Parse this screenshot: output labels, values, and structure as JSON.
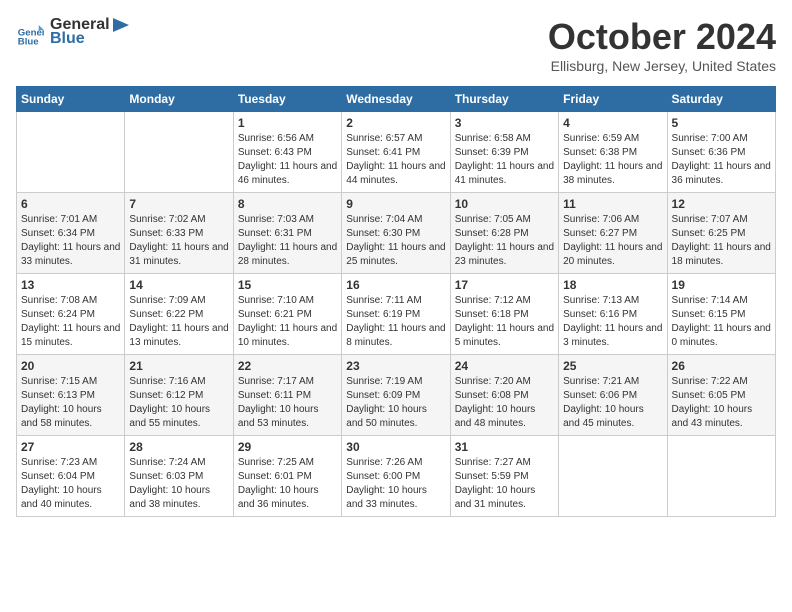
{
  "header": {
    "logo_line1": "General",
    "logo_line2": "Blue",
    "month": "October 2024",
    "location": "Ellisburg, New Jersey, United States"
  },
  "days_of_week": [
    "Sunday",
    "Monday",
    "Tuesday",
    "Wednesday",
    "Thursday",
    "Friday",
    "Saturday"
  ],
  "weeks": [
    [
      {
        "day": "",
        "info": ""
      },
      {
        "day": "",
        "info": ""
      },
      {
        "day": "1",
        "info": "Sunrise: 6:56 AM\nSunset: 6:43 PM\nDaylight: 11 hours and 46 minutes."
      },
      {
        "day": "2",
        "info": "Sunrise: 6:57 AM\nSunset: 6:41 PM\nDaylight: 11 hours and 44 minutes."
      },
      {
        "day": "3",
        "info": "Sunrise: 6:58 AM\nSunset: 6:39 PM\nDaylight: 11 hours and 41 minutes."
      },
      {
        "day": "4",
        "info": "Sunrise: 6:59 AM\nSunset: 6:38 PM\nDaylight: 11 hours and 38 minutes."
      },
      {
        "day": "5",
        "info": "Sunrise: 7:00 AM\nSunset: 6:36 PM\nDaylight: 11 hours and 36 minutes."
      }
    ],
    [
      {
        "day": "6",
        "info": "Sunrise: 7:01 AM\nSunset: 6:34 PM\nDaylight: 11 hours and 33 minutes."
      },
      {
        "day": "7",
        "info": "Sunrise: 7:02 AM\nSunset: 6:33 PM\nDaylight: 11 hours and 31 minutes."
      },
      {
        "day": "8",
        "info": "Sunrise: 7:03 AM\nSunset: 6:31 PM\nDaylight: 11 hours and 28 minutes."
      },
      {
        "day": "9",
        "info": "Sunrise: 7:04 AM\nSunset: 6:30 PM\nDaylight: 11 hours and 25 minutes."
      },
      {
        "day": "10",
        "info": "Sunrise: 7:05 AM\nSunset: 6:28 PM\nDaylight: 11 hours and 23 minutes."
      },
      {
        "day": "11",
        "info": "Sunrise: 7:06 AM\nSunset: 6:27 PM\nDaylight: 11 hours and 20 minutes."
      },
      {
        "day": "12",
        "info": "Sunrise: 7:07 AM\nSunset: 6:25 PM\nDaylight: 11 hours and 18 minutes."
      }
    ],
    [
      {
        "day": "13",
        "info": "Sunrise: 7:08 AM\nSunset: 6:24 PM\nDaylight: 11 hours and 15 minutes."
      },
      {
        "day": "14",
        "info": "Sunrise: 7:09 AM\nSunset: 6:22 PM\nDaylight: 11 hours and 13 minutes."
      },
      {
        "day": "15",
        "info": "Sunrise: 7:10 AM\nSunset: 6:21 PM\nDaylight: 11 hours and 10 minutes."
      },
      {
        "day": "16",
        "info": "Sunrise: 7:11 AM\nSunset: 6:19 PM\nDaylight: 11 hours and 8 minutes."
      },
      {
        "day": "17",
        "info": "Sunrise: 7:12 AM\nSunset: 6:18 PM\nDaylight: 11 hours and 5 minutes."
      },
      {
        "day": "18",
        "info": "Sunrise: 7:13 AM\nSunset: 6:16 PM\nDaylight: 11 hours and 3 minutes."
      },
      {
        "day": "19",
        "info": "Sunrise: 7:14 AM\nSunset: 6:15 PM\nDaylight: 11 hours and 0 minutes."
      }
    ],
    [
      {
        "day": "20",
        "info": "Sunrise: 7:15 AM\nSunset: 6:13 PM\nDaylight: 10 hours and 58 minutes."
      },
      {
        "day": "21",
        "info": "Sunrise: 7:16 AM\nSunset: 6:12 PM\nDaylight: 10 hours and 55 minutes."
      },
      {
        "day": "22",
        "info": "Sunrise: 7:17 AM\nSunset: 6:11 PM\nDaylight: 10 hours and 53 minutes."
      },
      {
        "day": "23",
        "info": "Sunrise: 7:19 AM\nSunset: 6:09 PM\nDaylight: 10 hours and 50 minutes."
      },
      {
        "day": "24",
        "info": "Sunrise: 7:20 AM\nSunset: 6:08 PM\nDaylight: 10 hours and 48 minutes."
      },
      {
        "day": "25",
        "info": "Sunrise: 7:21 AM\nSunset: 6:06 PM\nDaylight: 10 hours and 45 minutes."
      },
      {
        "day": "26",
        "info": "Sunrise: 7:22 AM\nSunset: 6:05 PM\nDaylight: 10 hours and 43 minutes."
      }
    ],
    [
      {
        "day": "27",
        "info": "Sunrise: 7:23 AM\nSunset: 6:04 PM\nDaylight: 10 hours and 40 minutes."
      },
      {
        "day": "28",
        "info": "Sunrise: 7:24 AM\nSunset: 6:03 PM\nDaylight: 10 hours and 38 minutes."
      },
      {
        "day": "29",
        "info": "Sunrise: 7:25 AM\nSunset: 6:01 PM\nDaylight: 10 hours and 36 minutes."
      },
      {
        "day": "30",
        "info": "Sunrise: 7:26 AM\nSunset: 6:00 PM\nDaylight: 10 hours and 33 minutes."
      },
      {
        "day": "31",
        "info": "Sunrise: 7:27 AM\nSunset: 5:59 PM\nDaylight: 10 hours and 31 minutes."
      },
      {
        "day": "",
        "info": ""
      },
      {
        "day": "",
        "info": ""
      }
    ]
  ]
}
